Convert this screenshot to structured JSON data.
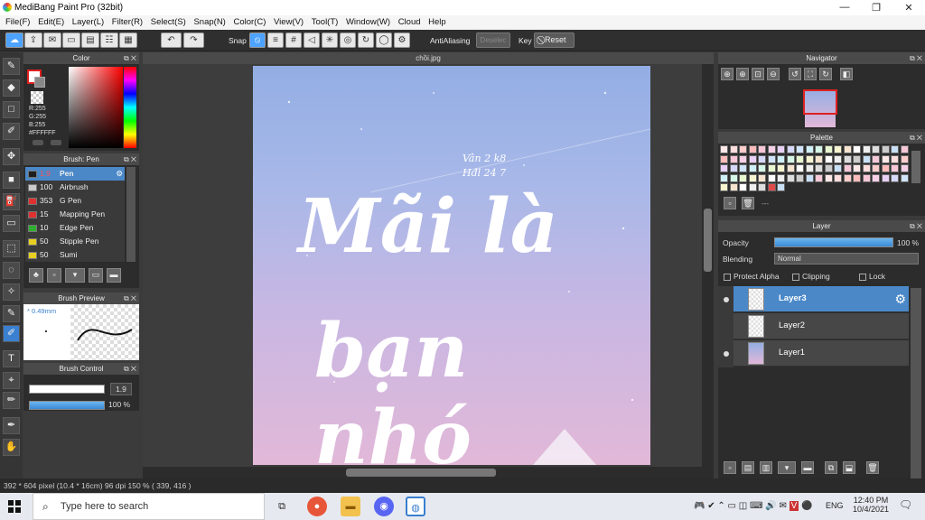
{
  "window": {
    "title": "MediBang Paint Pro (32bit)",
    "minimize": "—",
    "maximize": "❐",
    "close": "✕"
  },
  "menu": [
    "File(F)",
    "Edit(E)",
    "Layer(L)",
    "Filter(R)",
    "Select(S)",
    "Snap(N)",
    "Color(C)",
    "View(V)",
    "Tool(T)",
    "Window(W)",
    "Cloud",
    "Help"
  ],
  "toolbar": {
    "snap_label": "Snap",
    "antialiasing_label": "AntiAliasing",
    "deselect_label": "Deselec",
    "key_label": "Key",
    "reset_label": "Reset"
  },
  "color_panel": {
    "title": "Color",
    "r": "R:255",
    "g": "G:255",
    "b": "B:255",
    "hex": "#FFFFFF"
  },
  "brush_panel": {
    "title": "Brush: Pen",
    "items": [
      {
        "size": "1.9",
        "name": "Pen",
        "color": "#1e1e1e"
      },
      {
        "size": "100",
        "name": "Airbrush",
        "color": "#cccccc"
      },
      {
        "size": "353",
        "name": "G Pen",
        "color": "#e03030"
      },
      {
        "size": "15",
        "name": "Mapping Pen",
        "color": "#e03030"
      },
      {
        "size": "10",
        "name": "Edge Pen",
        "color": "#30b030"
      },
      {
        "size": "50",
        "name": "Stipple Pen",
        "color": "#e8d020"
      },
      {
        "size": "50",
        "name": "Sumi",
        "color": "#e8d020"
      }
    ]
  },
  "brush_preview": {
    "title": "Brush Preview",
    "size": "* 0.49mm"
  },
  "brush_control": {
    "title": "Brush Control",
    "size_value": "1.9",
    "opacity_value": "100 %"
  },
  "document": {
    "tab": "chồi.jpg"
  },
  "artwork": {
    "line1": "Mãi là",
    "line2": "bạn nhó",
    "signature_top": "Vân 2 k8",
    "signature_bottom": "Hđl 24 7"
  },
  "navigator": {
    "title": "Navigator"
  },
  "palette": {
    "title": "Palette",
    "ellipsis": "---"
  },
  "layer_panel": {
    "title": "Layer",
    "opacity_label": "Opacity",
    "opacity_value": "100 %",
    "blending_label": "Blending",
    "blending_value": "Normal",
    "protect_alpha": "Protect Alpha",
    "clipping": "Clipping",
    "lock": "Lock",
    "layers": [
      {
        "name": "Layer3"
      },
      {
        "name": "Layer2"
      },
      {
        "name": "Layer1"
      }
    ]
  },
  "status": {
    "text": "392 * 604 pixel  (10.4 * 16cm)  96 dpi  150 %  ( 339, 416 )"
  },
  "taskbar": {
    "search_placeholder": "Type here to search",
    "time": "12:40 PM",
    "date": "10/4/2021",
    "lang": "ENG"
  }
}
